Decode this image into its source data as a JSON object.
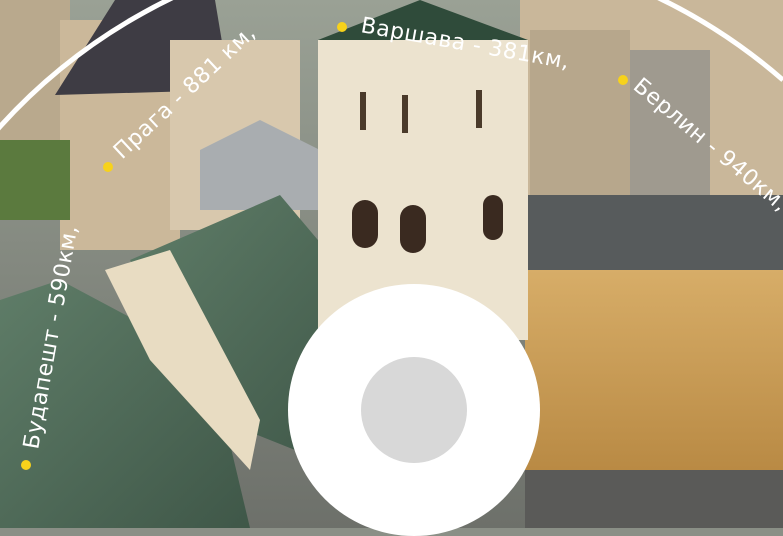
{
  "photo": {
    "subject": "aerial-city-view",
    "sky_color": "#ffffff",
    "roof_green": "#4d6b57",
    "facade_ochre": "#c89a52",
    "tower_cream": "#ece3cf"
  },
  "ring": {
    "color": "#ffffff",
    "dot_color": "#f7d21b"
  },
  "cities": [
    {
      "text": "Будапешт - 590км,"
    },
    {
      "text": "Прага - 881 км,"
    },
    {
      "text": "Варшава - 381км,"
    },
    {
      "text": "Берлин - 940км,"
    }
  ],
  "center": {
    "disc_color": "#ffffff",
    "dot_color": "#d8d8d8"
  }
}
